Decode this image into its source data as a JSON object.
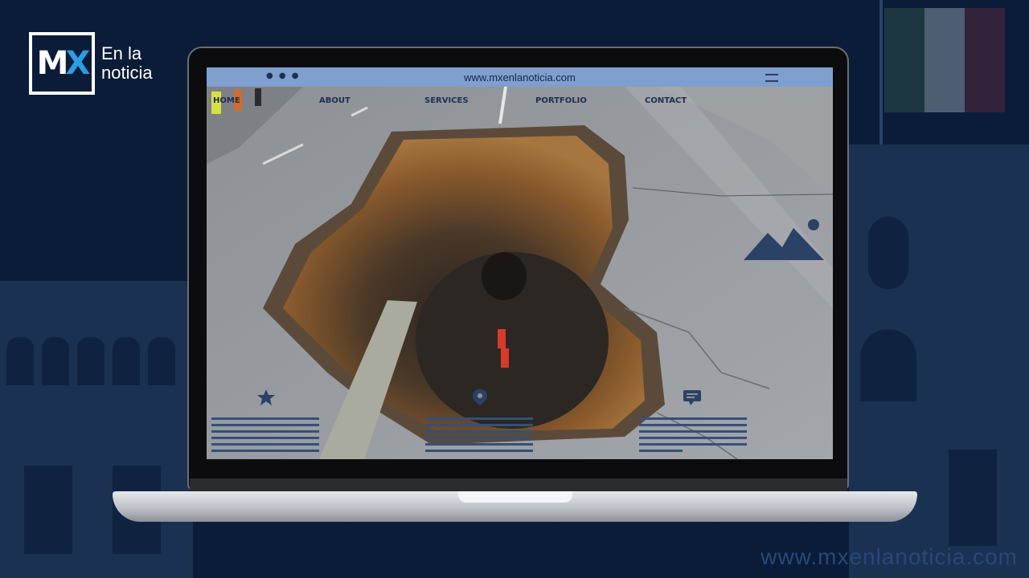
{
  "brand": {
    "logo_letters": "MX",
    "logo_text_line1": "En la",
    "logo_text_line2": "noticia"
  },
  "watermark": {
    "url": "www.mxenlanoticia.com"
  },
  "browser": {
    "url": "www.mxenlanoticia.com",
    "nav": [
      "HOME",
      "ABOUT",
      "SERVICES",
      "PORTFOLIO",
      "CONTACT"
    ]
  },
  "icons": {
    "menu": "hamburger-icon",
    "window_controls": "window-dots-icon",
    "gallery": "mountain-image-icon",
    "feature_1": "star-icon",
    "feature_2": "map-pin-icon",
    "feature_3": "chat-bubble-icon"
  },
  "colors": {
    "background": "#0b1c38",
    "address_bar": "#7f9fcf",
    "accent_blue": "#2b9de3",
    "placeholder_lines": "#33507a"
  }
}
